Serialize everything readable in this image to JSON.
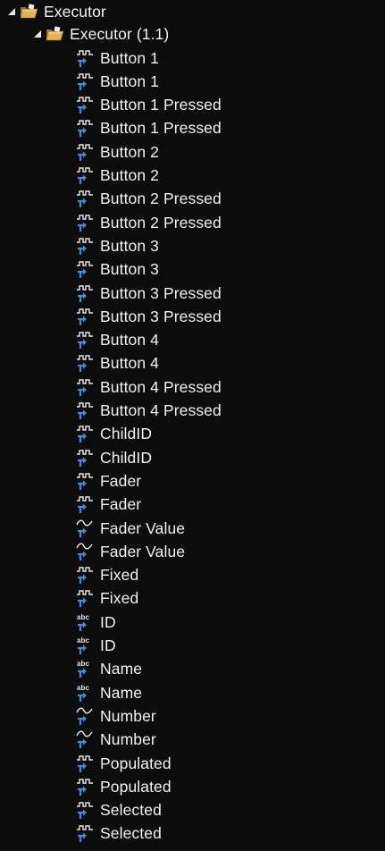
{
  "tree": {
    "root": {
      "label": "Executor",
      "icon": "folder-open-icon",
      "expanded": true,
      "child": {
        "label": "Executor (1.1)",
        "icon": "folder-open-icon",
        "expanded": true,
        "items": [
          {
            "label": "Button 1",
            "icon": "boolean-icon"
          },
          {
            "label": "Button 1",
            "icon": "boolean-icon"
          },
          {
            "label": "Button 1 Pressed",
            "icon": "boolean-icon"
          },
          {
            "label": "Button 1 Pressed",
            "icon": "boolean-icon"
          },
          {
            "label": "Button 2",
            "icon": "boolean-icon"
          },
          {
            "label": "Button 2",
            "icon": "boolean-icon"
          },
          {
            "label": "Button 2 Pressed",
            "icon": "boolean-icon"
          },
          {
            "label": "Button 2 Pressed",
            "icon": "boolean-icon"
          },
          {
            "label": "Button 3",
            "icon": "boolean-icon"
          },
          {
            "label": "Button 3",
            "icon": "boolean-icon"
          },
          {
            "label": "Button 3 Pressed",
            "icon": "boolean-icon"
          },
          {
            "label": "Button 3 Pressed",
            "icon": "boolean-icon"
          },
          {
            "label": "Button 4",
            "icon": "boolean-icon"
          },
          {
            "label": "Button 4",
            "icon": "boolean-icon"
          },
          {
            "label": "Button 4 Pressed",
            "icon": "boolean-icon"
          },
          {
            "label": "Button 4 Pressed",
            "icon": "boolean-icon"
          },
          {
            "label": "ChildID",
            "icon": "boolean-icon"
          },
          {
            "label": "ChildID",
            "icon": "boolean-icon"
          },
          {
            "label": "Fader",
            "icon": "boolean-icon"
          },
          {
            "label": "Fader",
            "icon": "boolean-icon"
          },
          {
            "label": "Fader Value",
            "icon": "analog-icon"
          },
          {
            "label": "Fader Value",
            "icon": "analog-icon"
          },
          {
            "label": "Fixed",
            "icon": "boolean-icon"
          },
          {
            "label": "Fixed",
            "icon": "boolean-icon"
          },
          {
            "label": "ID",
            "icon": "string-icon"
          },
          {
            "label": "ID",
            "icon": "string-icon"
          },
          {
            "label": "Name",
            "icon": "string-icon"
          },
          {
            "label": "Name",
            "icon": "string-icon"
          },
          {
            "label": "Number",
            "icon": "analog-icon"
          },
          {
            "label": "Number",
            "icon": "analog-icon"
          },
          {
            "label": "Populated",
            "icon": "boolean-icon"
          },
          {
            "label": "Populated",
            "icon": "boolean-icon"
          },
          {
            "label": "Selected",
            "icon": "boolean-icon"
          },
          {
            "label": "Selected",
            "icon": "boolean-icon"
          }
        ]
      }
    },
    "colors": {
      "background": "#0c0c0c",
      "text": "#f2f2f2",
      "arrow": "#3b8ee8",
      "folder": "#e0b552"
    }
  }
}
